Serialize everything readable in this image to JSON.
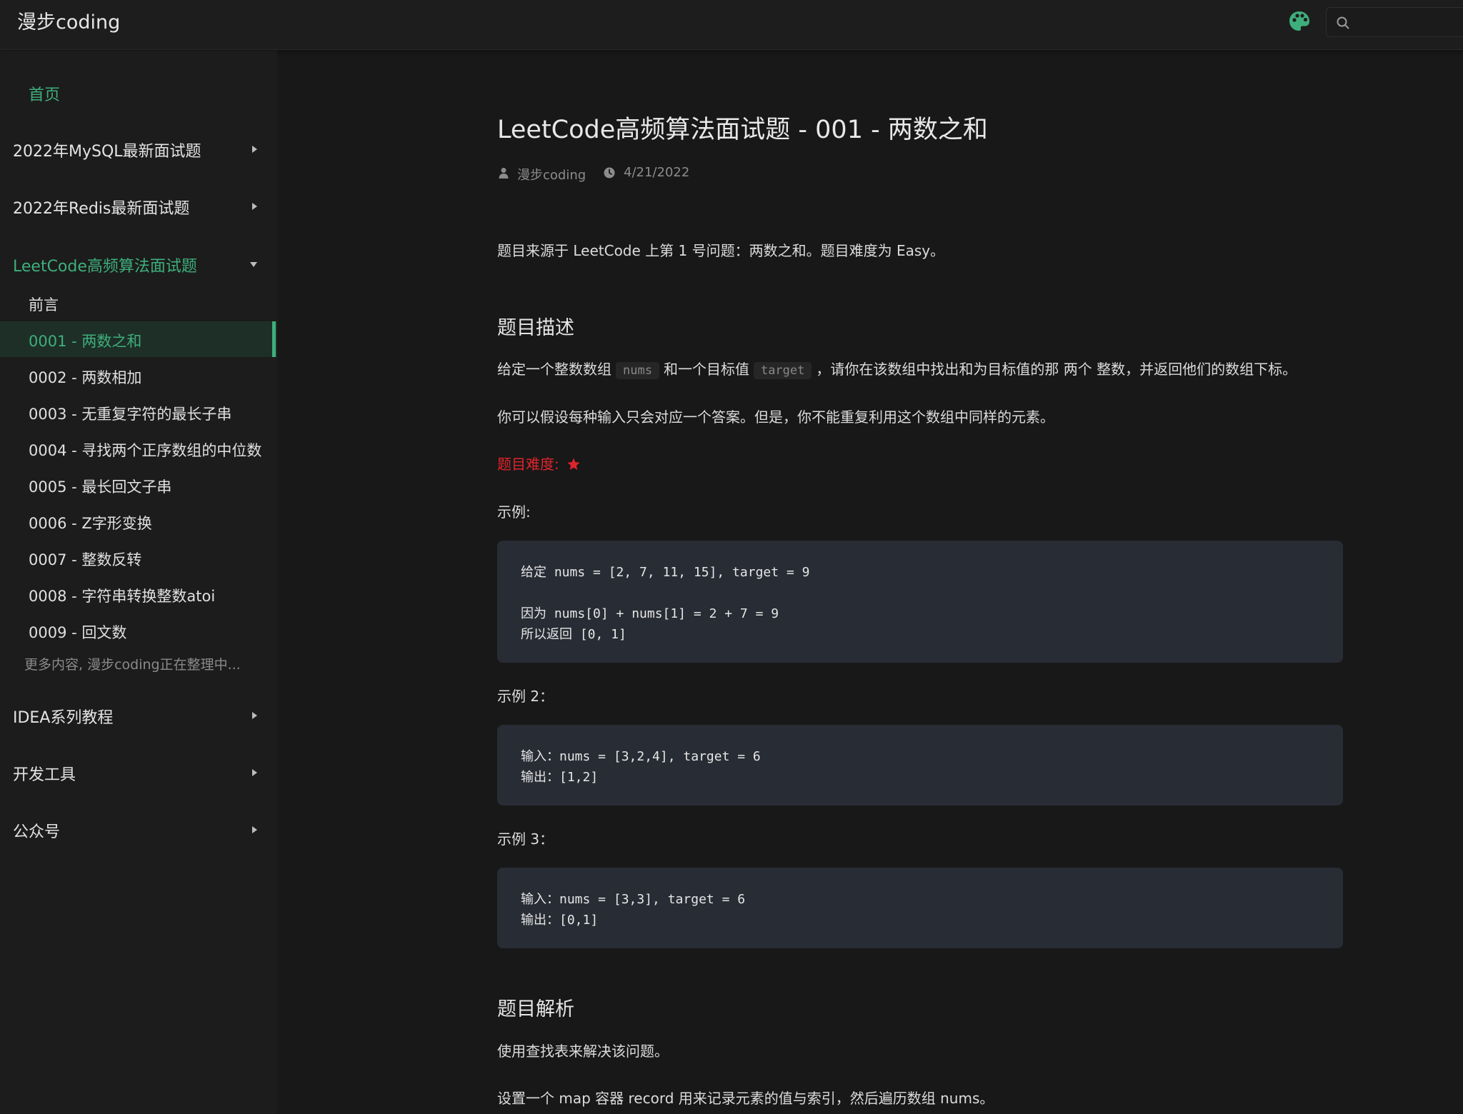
{
  "navbar": {
    "site_title": "漫步coding",
    "search_placeholder": ""
  },
  "colors": {
    "accent": "#3eaf7c",
    "difficulty": "#e0242c",
    "code_bg": "#282c34"
  },
  "sidebar": {
    "home": "首页",
    "groups": [
      {
        "label": "2022年MySQL最新面试题",
        "expanded": false
      },
      {
        "label": "2022年Redis最新面试题",
        "expanded": false
      },
      {
        "label": "LeetCode高频算法面试题",
        "expanded": true
      },
      {
        "label": "IDEA系列教程",
        "expanded": false
      },
      {
        "label": "开发工具",
        "expanded": false
      },
      {
        "label": "公众号",
        "expanded": false
      }
    ],
    "items": [
      "前言",
      "0001 - 两数之和",
      "0002 - 两数相加",
      "0003 - 无重复字符的最长子串",
      "0004 - 寻找两个正序数组的中位数",
      "0005 - 最长回文子串",
      "0006 - Z字形变换",
      "0007 - 整数反转",
      "0008 - 字符串转换整数atoi",
      "0009 - 回文数"
    ],
    "active_item": "0001 - 两数之和",
    "more_text": "更多内容, 漫步coding正在整理中..."
  },
  "article": {
    "title": "LeetCode高频算法面试题 - 001 - 两数之和",
    "author": "漫步coding",
    "date": "4/21/2022",
    "intro": "题目来源于 LeetCode 上第 1 号问题：两数之和。题目难度为 Easy。",
    "h_desc": "题目描述",
    "desc_part1": "给定一个整数数组",
    "desc_code1": "nums",
    "desc_part2": "和一个目标值",
    "desc_code2": "target",
    "desc_part3": "，请你在该数组中找出和为目标值的那 两个 整数，并返回他们的数组下标。",
    "desc2": "你可以假设每种输入只会对应一个答案。但是，你不能重复利用这个数组中同样的元素。",
    "difficulty_label": "题目难度: ",
    "difficulty_stars": 1,
    "example1_label": "示例:",
    "example1_lines": [
      "给定 nums = [2, 7, 11, 15], target = 9",
      "因为 nums[0] + nums[1] = 2 + 7 = 9",
      "所以返回 [0, 1]"
    ],
    "example2_label": "示例 2：",
    "example2_lines": [
      "输入：nums = [3,2,4], target = 6",
      "输出：[1,2]"
    ],
    "example3_label": "示例 3：",
    "example3_lines": [
      "输入：nums = [3,3], target = 6",
      "输出：[0,1]"
    ],
    "h_analysis": "题目解析",
    "analysis1": "使用查找表来解决该问题。",
    "analysis2": "设置一个 map 容器 record 用来记录元素的值与索引，然后遍历数组 nums。"
  }
}
